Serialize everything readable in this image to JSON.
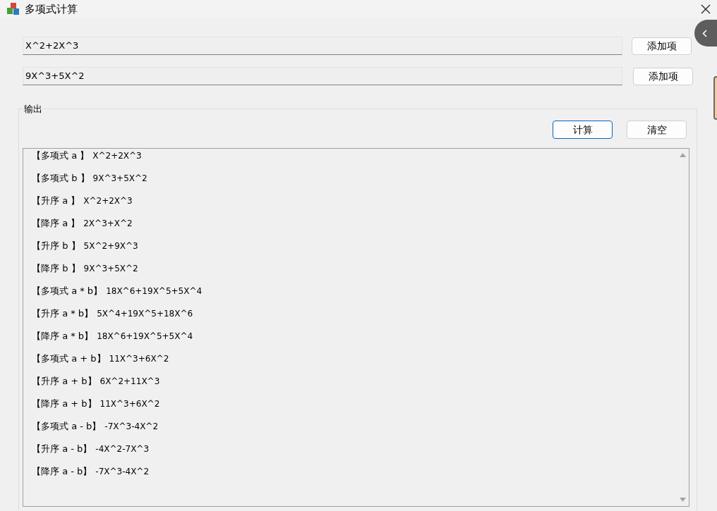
{
  "window": {
    "title": "多项式计算"
  },
  "inputs": [
    {
      "value": "X^2+2X^3",
      "button": "添加项"
    },
    {
      "value": "9X^3+5X^2",
      "button": "添加项"
    }
  ],
  "output": {
    "title": "输出",
    "buttons": [
      {
        "label": "计算",
        "focused": true
      },
      {
        "label": "清空",
        "focused": false
      }
    ],
    "lines": [
      {
        "label": "【多项式 a 】",
        "value": "X^2+2X^3"
      },
      {
        "label": "【多项式 b 】",
        "value": "9X^3+5X^2"
      },
      {
        "label": "【升序 a 】",
        "value": "X^2+2X^3"
      },
      {
        "label": "【降序 a 】",
        "value": "2X^3+X^2"
      },
      {
        "label": "【升序 b 】",
        "value": "5X^2+9X^3"
      },
      {
        "label": "【降序 b 】",
        "value": "9X^3+5X^2"
      },
      {
        "label": "【多项式 a * b】",
        "value": "18X^6+19X^5+5X^4"
      },
      {
        "label": "【升序 a * b】",
        "value": "5X^4+19X^5+18X^6"
      },
      {
        "label": "【降序 a * b】",
        "value": "18X^6+19X^5+5X^4"
      },
      {
        "label": "【多项式 a + b】",
        "value": "11X^3+6X^2"
      },
      {
        "label": "【升序 a + b】",
        "value": "6X^2+11X^3"
      },
      {
        "label": "【降序 a + b】",
        "value": "11X^3+6X^2"
      },
      {
        "label": "【多项式 a - b】",
        "value": "-7X^3-4X^2"
      },
      {
        "label": "【升序 a - b】",
        "value": "-4X^2-7X^3"
      },
      {
        "label": "【降序 a - b】",
        "value": "-7X^3-4X^2"
      }
    ]
  }
}
